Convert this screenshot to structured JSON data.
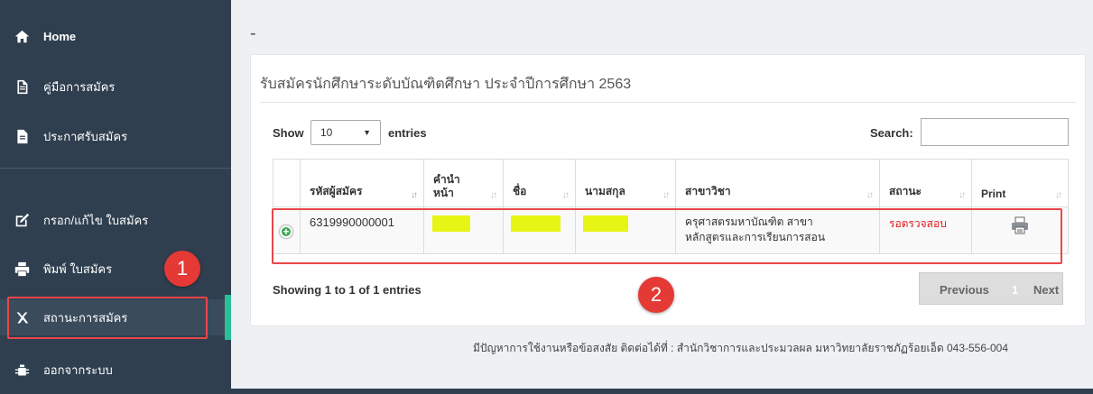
{
  "sidebar": {
    "items": [
      {
        "label": "Home",
        "icon": "home-icon"
      },
      {
        "label": "คู่มือการสมัคร",
        "icon": "document-icon"
      },
      {
        "label": "ประกาศรับสมัคร",
        "icon": "file-icon"
      },
      {
        "label": "กรอก/แก้ไข ใบสมัคร",
        "icon": "edit-icon"
      },
      {
        "label": "พิมพ์ ใบสมัคร",
        "icon": "print-icon"
      },
      {
        "label": "สถานะการสมัคร",
        "icon": "status-icon"
      },
      {
        "label": "ออกจากระบบ",
        "icon": "bug-icon"
      }
    ],
    "active_index": 5
  },
  "annotations": {
    "badge1": "1",
    "badge2": "2",
    "highlight_color": "#e53935"
  },
  "header": {
    "dash": "-"
  },
  "panel": {
    "title": "รับสมัครนักศึกษาระดับบัณฑิตศึกษา ประจำปีการศึกษา 2563",
    "show_label": "Show",
    "entries_value": "10",
    "entries_label": "entries",
    "search_label": "Search:",
    "search_value": ""
  },
  "table": {
    "columns": [
      "รหัสผู้สมัคร",
      "คำนำหน้า",
      "ชื่อ",
      "นามสกุล",
      "สาขาวิชา",
      "สถานะ",
      "Print"
    ],
    "rows": [
      {
        "id": "6319990000001",
        "prefix": "",
        "first_name": "",
        "last_name": "",
        "major_line1": "ครุศาสตรมหาบัณฑิต สาขา",
        "major_line2": "หลักสูตรและการเรียนการสอน",
        "status": "รอตรวจสอบ",
        "status_color": "#e31b1b"
      }
    ],
    "info": "Showing 1 to 1 of 1 entries",
    "pager": {
      "previous": "Previous",
      "current": "1",
      "next": "Next"
    }
  },
  "footer": {
    "text": "มีปัญหาการใช้งานหรือข้อสงสัย ติดต่อได้ที่ : สำนักวิชาการและประมวลผล มหาวิทยาลัยราชภัฏร้อยเอ็ด 043-556-004"
  }
}
